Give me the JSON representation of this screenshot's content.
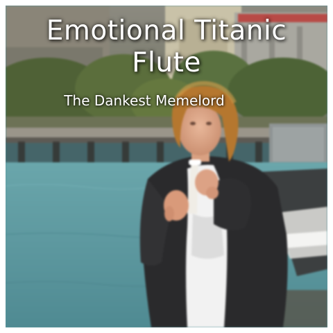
{
  "title": {
    "line1": "Emotional Titanic",
    "line2": "Flute"
  },
  "subtitle": "The Dankest Memelord",
  "colors": {
    "border": "#ffffff",
    "water": "#5f9aa2",
    "jacket": "#2a2a2c",
    "shirt": "#f2f2f2",
    "hair": "#b5772f",
    "text": "#ffffff"
  },
  "scene": {
    "subject": "man-playing-recorder-flute",
    "background": "waterfront-pier-with-trees"
  }
}
